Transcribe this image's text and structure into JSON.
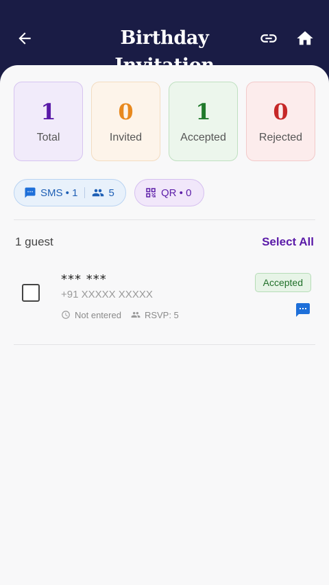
{
  "header": {
    "title": "Birthday Invitation",
    "back_icon": "arrow-left-icon",
    "link_icon": "link-icon",
    "home_icon": "home-icon"
  },
  "stats": {
    "total": {
      "value": "1",
      "label": "Total"
    },
    "invited": {
      "value": "0",
      "label": "Invited"
    },
    "accepted": {
      "value": "1",
      "label": "Accepted"
    },
    "rejected": {
      "value": "0",
      "label": "Rejected"
    }
  },
  "chips": {
    "sms": {
      "label": "SMS • 1",
      "group_count": "5"
    },
    "qr": {
      "label": "QR • 0"
    }
  },
  "list": {
    "count_label": "1 guest",
    "select_all_label": "Select All",
    "guests": [
      {
        "name": "*** ***",
        "phone": "+91 XXXXX XXXXX",
        "entry_status": "Not entered",
        "rsvp": "RSVP: 5",
        "status": "Accepted"
      }
    ]
  },
  "colors": {
    "header_bg": "#1a1c45",
    "accent": "#5a1aa8",
    "accepted": "#207a2b",
    "invited": "#e8891e",
    "rejected": "#c62828"
  }
}
